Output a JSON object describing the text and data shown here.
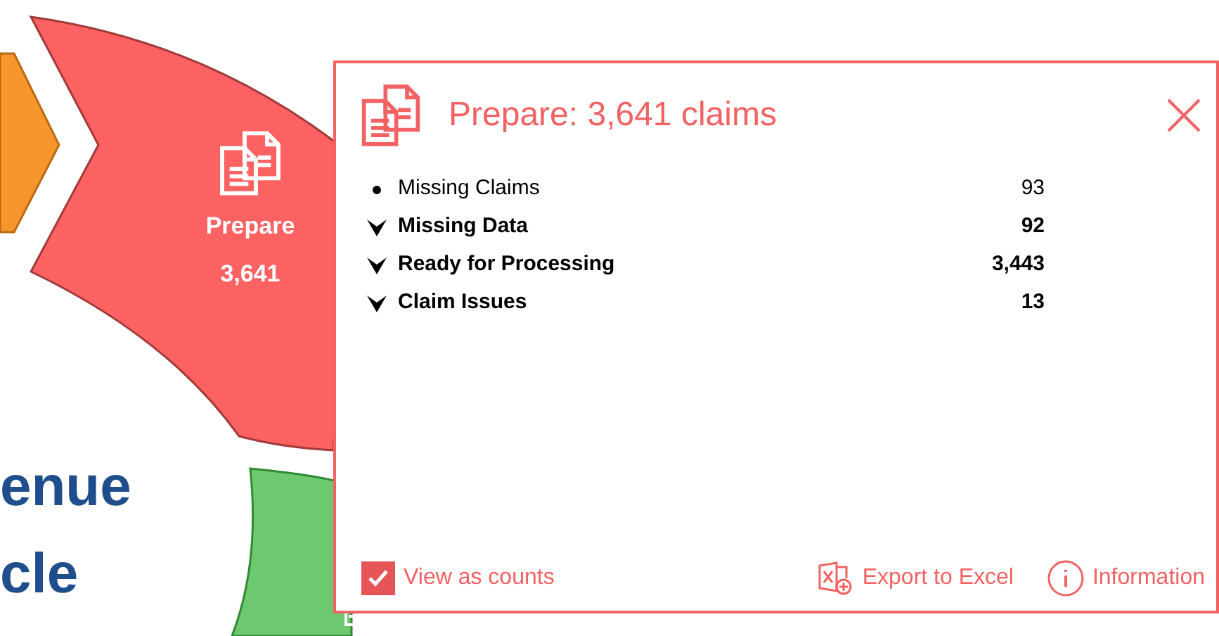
{
  "diagram": {
    "stage": {
      "label": "Prepare",
      "count": "3,641"
    },
    "title_lines": [
      "enue",
      "cle"
    ]
  },
  "panel": {
    "title": "Prepare: 3,641 claims",
    "rows": [
      {
        "kind": "leaf",
        "label": "Missing Claims",
        "value": "93"
      },
      {
        "kind": "group",
        "label": "Missing Data",
        "value": "92"
      },
      {
        "kind": "group",
        "label": "Ready for Processing",
        "value": "3,443"
      },
      {
        "kind": "group",
        "label": "Claim Issues",
        "value": "13"
      }
    ],
    "view_as_counts": {
      "label": "View as counts",
      "checked": true
    },
    "export": "Export to Excel",
    "information": "Information"
  }
}
